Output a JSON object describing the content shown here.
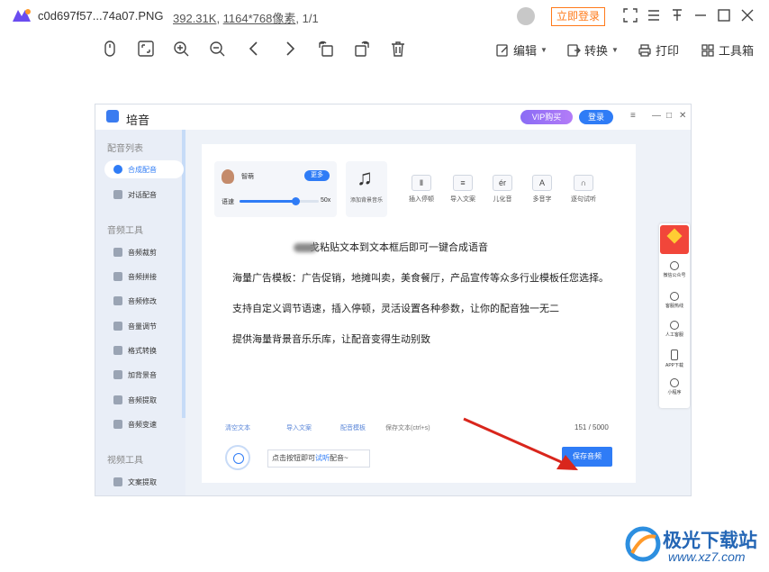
{
  "titlebar": {
    "filename": "c0d697f57...74a07.PNG",
    "filesize": "392.31K",
    "dimensions": "1164*768像素",
    "page": "1/1",
    "login_label": "立即登录"
  },
  "toolbar": {
    "edit_label": "编辑",
    "convert_label": "转换",
    "print_label": "打印",
    "toolbox_label": "工具箱"
  },
  "app": {
    "name": "培音",
    "vip_label": "VIP购买",
    "login_label": "登录",
    "sidebar": {
      "section1": "配音列表",
      "section2": "音频工具",
      "section3": "视频工具",
      "items1": [
        "合成配音",
        "对话配音"
      ],
      "items2": [
        "音频裁剪",
        "音频拼接",
        "音频修改",
        "音量调节",
        "格式转换",
        "加背景音",
        "音频提取",
        "音频变速"
      ],
      "items3": [
        "文案提取"
      ]
    },
    "voice": {
      "name": "智萌",
      "more_label": "更多",
      "speed_label": "语速",
      "speed_max": "50x",
      "speed_value": 0.7
    },
    "bgm_label": "添加背景音乐",
    "tools": [
      {
        "icon": "Ⅱ",
        "label": "插入停顿"
      },
      {
        "icon": "≡",
        "label": "导入文案"
      },
      {
        "icon": "ér",
        "label": "儿化音"
      },
      {
        "icon": "A",
        "label": "多音字"
      },
      {
        "icon": "∩",
        "label": "逐句试听"
      }
    ],
    "editor_lines": [
      "戈粘贴文本到文本框后即可一键合成语音",
      "海量广告模板：广告促销，地摊叫卖，美食餐厅，产品宣传等众多行业模板任您选择。",
      "支持自定义调节语速，插入停顿，灵活设置各种参数，让你的配音独一无二",
      "提供海量背景音乐乐库，让配音变得生动别致"
    ],
    "bottom": {
      "clear": "清空文本",
      "import": "导入文案",
      "template": "配音模板",
      "save_text": "保存文本(ctrl+s)",
      "count": "151 / 5000"
    },
    "hint_prefix": "点击按钮即可",
    "hint_highlight": "试听",
    "hint_suffix": "配音~",
    "save_audio": "保存音频",
    "float": [
      {
        "label": "微信公众号"
      },
      {
        "label": "客服热线"
      },
      {
        "label": "人工客服"
      },
      {
        "label": "APP下载"
      },
      {
        "label": "小程序"
      }
    ]
  },
  "watermark": {
    "title": "极光下载站",
    "url": "www.xz7.com"
  },
  "colors": {
    "accent": "#2f7cf6",
    "login_orange": "#ff7a1a",
    "arrow_red": "#d9261c"
  }
}
